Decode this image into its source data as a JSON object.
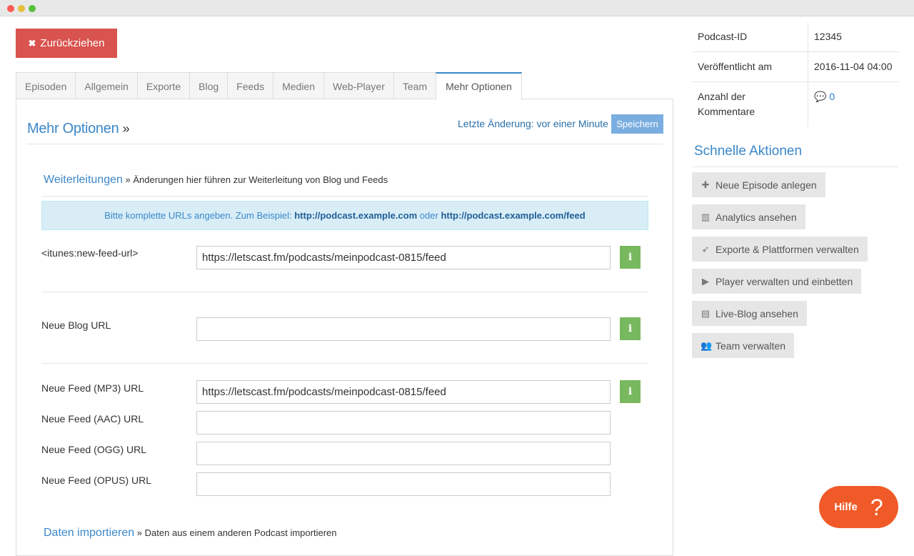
{
  "window": {
    "title": ""
  },
  "actions": {
    "retract_label": "Zurückziehen"
  },
  "tabs": [
    {
      "label": "Episoden"
    },
    {
      "label": "Allgemein"
    },
    {
      "label": "Exporte"
    },
    {
      "label": "Blog"
    },
    {
      "label": "Feeds"
    },
    {
      "label": "Medien"
    },
    {
      "label": "Web-Player"
    },
    {
      "label": "Team"
    },
    {
      "label": "Mehr Optionen",
      "active": true
    }
  ],
  "panel": {
    "title": "Mehr Optionen",
    "last_change_label": "Letzte Änderung: vor einer Minute",
    "save_label": "Speichern"
  },
  "redirects": {
    "heading": "Weiterleitungen",
    "description": "Änderungen hier führen zur Weiterleitung von Blog und Feeds",
    "info_prefix": "Bitte komplette URLs angeben. Zum Beispiel:",
    "info_example1": "http://podcast.example.com",
    "info_or": "oder",
    "info_example2": "http://podcast.example.com/feed",
    "fields": [
      {
        "label": "<itunes:new-feed-url>",
        "value": "https://letscast.fm/podcasts/meinpodcast-0815/feed"
      },
      {
        "label": "Neue Blog URL",
        "value": ""
      },
      {
        "label": "Neue Feed (MP3) URL",
        "value": "https://letscast.fm/podcasts/meinpodcast-0815/feed"
      },
      {
        "label": "Neue Feed (AAC) URL",
        "value": ""
      },
      {
        "label": "Neue Feed (OGG) URL",
        "value": ""
      },
      {
        "label": "Neue Feed (OPUS) URL",
        "value": ""
      }
    ],
    "info_button_label": "i"
  },
  "import_section": {
    "heading": "Daten importieren",
    "description": "Daten aus einem anderen Podcast importieren"
  },
  "meta": {
    "podcast_id_label": "Podcast-ID",
    "podcast_id_value": "12345",
    "published_label": "Veröffentlicht am",
    "published_value": "2016-11-04 04:00",
    "comments_label": "Anzahl der Kommentare",
    "comments_value": "0"
  },
  "quick_actions": {
    "title": "Schnelle Aktionen",
    "items": [
      {
        "label": "Neue Episode anlegen",
        "icon": "plus-icon"
      },
      {
        "label": "Analytics ansehen",
        "icon": "bar-chart-icon"
      },
      {
        "label": "Exporte & Plattformen verwalten",
        "icon": "rocket-icon"
      },
      {
        "label": "Player verwalten und einbetten",
        "icon": "play-circle-icon"
      },
      {
        "label": "Live-Blog ansehen",
        "icon": "browser-window-icon"
      },
      {
        "label": "Team verwalten",
        "icon": "users-icon"
      }
    ]
  },
  "help": {
    "label": "Hilfe",
    "glyph": "?"
  },
  "colors": {
    "accent": "#3a87c8",
    "danger": "#d9534f",
    "success": "#78b85f",
    "help": "#f05a28",
    "info_bg": "#d9edf7"
  }
}
